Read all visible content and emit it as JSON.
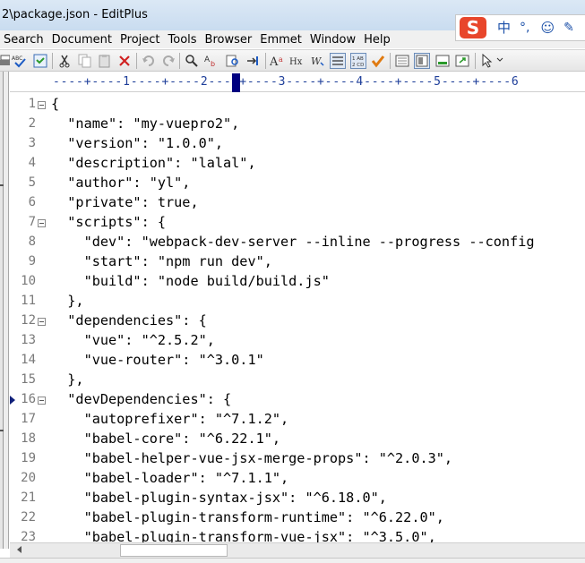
{
  "window": {
    "title": "2\\package.json - EditPlus"
  },
  "ime": {
    "logo": "S",
    "items": [
      "中",
      "°,",
      "☺",
      "✎"
    ]
  },
  "menu": [
    "Search",
    "Document",
    "Project",
    "Tools",
    "Browser",
    "Emmet",
    "Window",
    "Help"
  ],
  "ruler": {
    "text": "----+----1----+----2----+----3----+----4----+----5----+----6"
  },
  "editor": {
    "lines": [
      {
        "n": "1",
        "text": "{",
        "fold": true
      },
      {
        "n": "2",
        "text": "  \"name\": \"my-vuepro2\","
      },
      {
        "n": "3",
        "text": "  \"version\": \"1.0.0\","
      },
      {
        "n": "4",
        "text": "  \"description\": \"lalal\","
      },
      {
        "n": "5",
        "text": "  \"author\": \"yl\","
      },
      {
        "n": "6",
        "text": "  \"private\": true,"
      },
      {
        "n": "7",
        "text": "  \"scripts\": {",
        "fold": true
      },
      {
        "n": "8",
        "text": "    \"dev\": \"webpack-dev-server --inline --progress --config"
      },
      {
        "n": "9",
        "text": "    \"start\": \"npm run dev\","
      },
      {
        "n": "10",
        "text": "    \"build\": \"node build/build.js\""
      },
      {
        "n": "11",
        "text": "  },"
      },
      {
        "n": "12",
        "text": "  \"dependencies\": {",
        "fold": true
      },
      {
        "n": "13",
        "text": "    \"vue\": \"^2.5.2\","
      },
      {
        "n": "14",
        "text": "    \"vue-router\": \"^3.0.1\""
      },
      {
        "n": "15",
        "text": "  },"
      },
      {
        "n": "16",
        "text": "  \"devDependencies\": {",
        "fold": true,
        "bookmark": true
      },
      {
        "n": "17",
        "text": "    \"autoprefixer\": \"^7.1.2\","
      },
      {
        "n": "18",
        "text": "    \"babel-core\": \"^6.22.1\","
      },
      {
        "n": "19",
        "text": "    \"babel-helper-vue-jsx-merge-props\": \"^2.0.3\","
      },
      {
        "n": "20",
        "text": "    \"babel-loader\": \"^7.1.1\","
      },
      {
        "n": "21",
        "text": "    \"babel-plugin-syntax-jsx\": \"^6.18.0\","
      },
      {
        "n": "22",
        "text": "    \"babel-plugin-transform-runtime\": \"^6.22.0\","
      },
      {
        "n": "23",
        "text": "    \"babel-plugin-transform-vue-jsx\": \"^3.5.0\","
      }
    ]
  }
}
